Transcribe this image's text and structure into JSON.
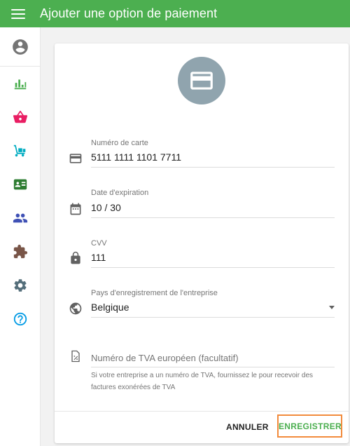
{
  "appbar": {
    "title": "Ajouter une option de paiement"
  },
  "colors": {
    "primary": "#4caf50",
    "focus_outline": "#f28b3c",
    "card_avatar": "#90a4ae"
  },
  "sidebar": {
    "items": [
      {
        "name": "account",
        "icon": "account-circle-icon",
        "color": "#757575"
      },
      {
        "name": "stats",
        "icon": "bar-chart-icon",
        "color": "#4caf50"
      },
      {
        "name": "shop",
        "icon": "basket-icon",
        "color": "#e91e63"
      },
      {
        "name": "orders",
        "icon": "trolley-icon",
        "color": "#00acc1"
      },
      {
        "name": "contacts",
        "icon": "contact-card-icon",
        "color": "#2e7d32"
      },
      {
        "name": "users",
        "icon": "people-icon",
        "color": "#3f51b5"
      },
      {
        "name": "extensions",
        "icon": "puzzle-icon",
        "color": "#795548"
      },
      {
        "name": "settings",
        "icon": "gear-icon",
        "color": "#546e7a"
      },
      {
        "name": "help",
        "icon": "help-icon",
        "color": "#039be5"
      }
    ]
  },
  "form": {
    "card_number": {
      "label": "Numéro de carte",
      "value": "5111 1111 1101 7711",
      "icon": "credit-card-icon"
    },
    "expiry": {
      "label": "Date d'expiration",
      "value": "10 / 30",
      "icon": "calendar-icon"
    },
    "cvv": {
      "label": "CVV",
      "value": "111",
      "icon": "lock-icon"
    },
    "country": {
      "label": "Pays d'enregistrement de l'entreprise",
      "value": "Belgique",
      "icon": "globe-icon"
    },
    "vat": {
      "placeholder": "Numéro de TVA européen (facultatif)",
      "hint": "Si votre entreprise a un numéro de TVA, fournissez le pour recevoir des factures exonérées de TVA",
      "icon": "percent-document-icon"
    }
  },
  "actions": {
    "cancel_label": "ANNULER",
    "save_label": "ENREGISTRER"
  }
}
